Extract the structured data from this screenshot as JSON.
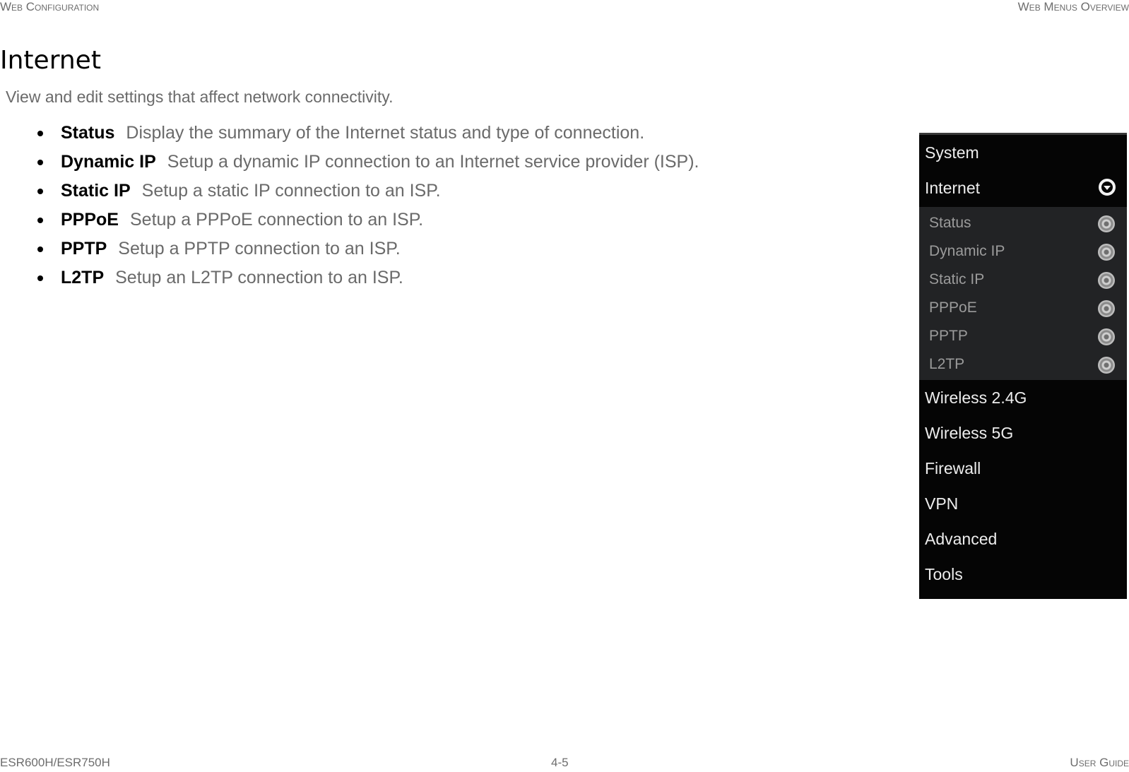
{
  "header": {
    "left": "Web Configuration",
    "right": "Web Menus Overview"
  },
  "section": {
    "title": "Internet",
    "intro": "View and edit settings that affect network connectivity."
  },
  "bullets": [
    {
      "term": "Status",
      "description": "Display the summary of the Internet status and type of connection."
    },
    {
      "term": "Dynamic IP",
      "description": "Setup a dynamic IP connection to an Internet service provider (ISP)."
    },
    {
      "term": "Static IP",
      "description": "Setup a static IP connection to an ISP."
    },
    {
      "term": "PPPoE",
      "description": "Setup a PPPoE connection to an ISP."
    },
    {
      "term": "PPTP",
      "description": "Setup a PPTP connection to an ISP."
    },
    {
      "term": "L2TP",
      "description": "Setup an L2TP connection to an ISP."
    }
  ],
  "menu_screenshot": {
    "top_items": [
      "System",
      "Internet"
    ],
    "expanded_item": "Internet",
    "expanded_icon": "chevron-down-circle-icon",
    "sub_items": [
      "Status",
      "Dynamic IP",
      "Static IP",
      "PPPoE",
      "PPTP",
      "L2TP"
    ],
    "sub_item_icon": "radio-ring-icon",
    "bottom_items": [
      "Wireless 2.4G",
      "Wireless 5G",
      "Firewall",
      "VPN",
      "Advanced",
      "Tools"
    ],
    "colors": {
      "menu_bg": "#050505",
      "submenu_bg": "#222325",
      "menu_text": "#ededed",
      "submenu_text": "#9b9b9b"
    }
  },
  "footer": {
    "left": "ESR600H/ESR750H",
    "center": "4-5",
    "right": "User Guide"
  }
}
